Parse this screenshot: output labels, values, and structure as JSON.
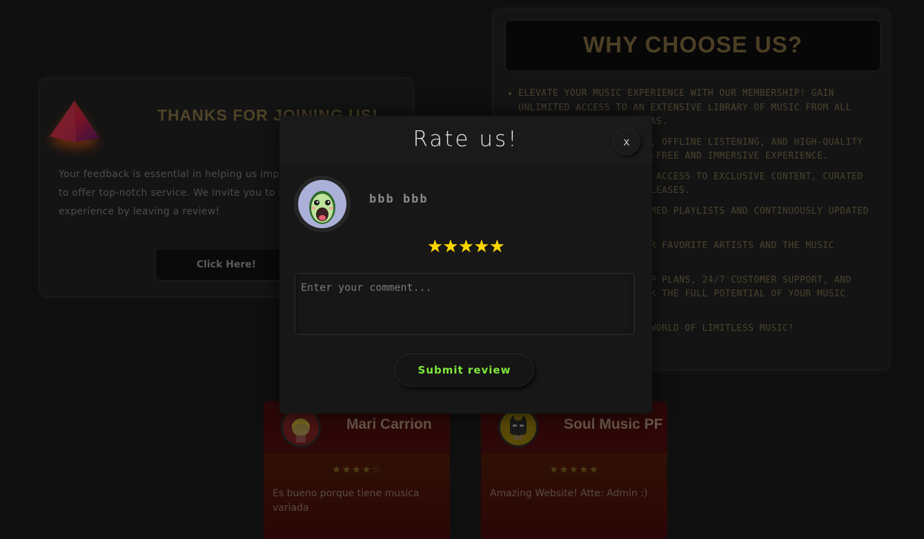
{
  "thanks_card": {
    "title": "THANKS FOR JOINING US!",
    "text": "Your feedback is essential in helping us improve and continue to offer top-notch service. We invite you to share your experience by leaving a review!",
    "button_label": "Click Here!"
  },
  "why_card": {
    "title": "WHY CHOOSE US?",
    "items": [
      "ELEVATE YOUR MUSIC EXPERIENCE WITH OUR MEMBERSHIP! GAIN UNLIMITED ACCESS TO AN EXTENSIVE LIBRARY OF MUSIC FROM ALL GENRES, ARTISTS, AND ERAS.",
      "ENJOY AD-FREE STREAMING, OFFLINE LISTENING, AND HIGH-QUALITY AUDIO FOR A DISTRACTION-FREE AND IMMERSIVE EXPERIENCE.",
      "AS A MEMBER, YOU'LL GET ACCESS TO EXCLUSIVE CONTENT, CURATED PLAYLISTS, AND EARLY RELEASES.",
      "DISCOVER HANDPICKED THEMED PLAYLISTS AND CONTINUOUSLY UPDATED RECOMMENDATIONS.",
      "STAY CONNECTED WITH YOUR FAVORITE ARTISTS AND THE MUSIC INDUSTRY.",
      "WITH FLEXIBLE MEMBERSHIP PLANS, 24/7 CUSTOMER SUPPORT, AND MORE, JOIN NOW TO UNLOCK THE FULL POTENTIAL OF YOUR MUSIC JOURNEY.",
      "JOIN TODAY AND ENTER A WORLD OF LIMITLESS MUSIC!"
    ]
  },
  "reviews": [
    {
      "name": "Mari Carrion",
      "stars": "★★★★☆",
      "text": "Es bueno porque tiene musica variada"
    },
    {
      "name": "Soul Music PF",
      "stars": "★★★★★",
      "text": "Amazing Website! Atte: Admin :)"
    }
  ],
  "modal": {
    "title": "Rate us!",
    "close_label": "x",
    "user_name": "bbb bbb",
    "stars": [
      "★",
      "★",
      "★",
      "★",
      "★"
    ],
    "comment_placeholder": "Enter your comment...",
    "submit_label": "Submit review"
  },
  "colors": {
    "star": "#ffd700",
    "submit_text": "#7ee83f",
    "review_card": "#2a0707"
  },
  "icons": {
    "thanks_logo": "prism-icon",
    "user_avatar": "avocado-avatar-icon",
    "review_1_avatar": "girl-avatar-icon",
    "review_2_avatar": "batman-avatar-icon"
  }
}
